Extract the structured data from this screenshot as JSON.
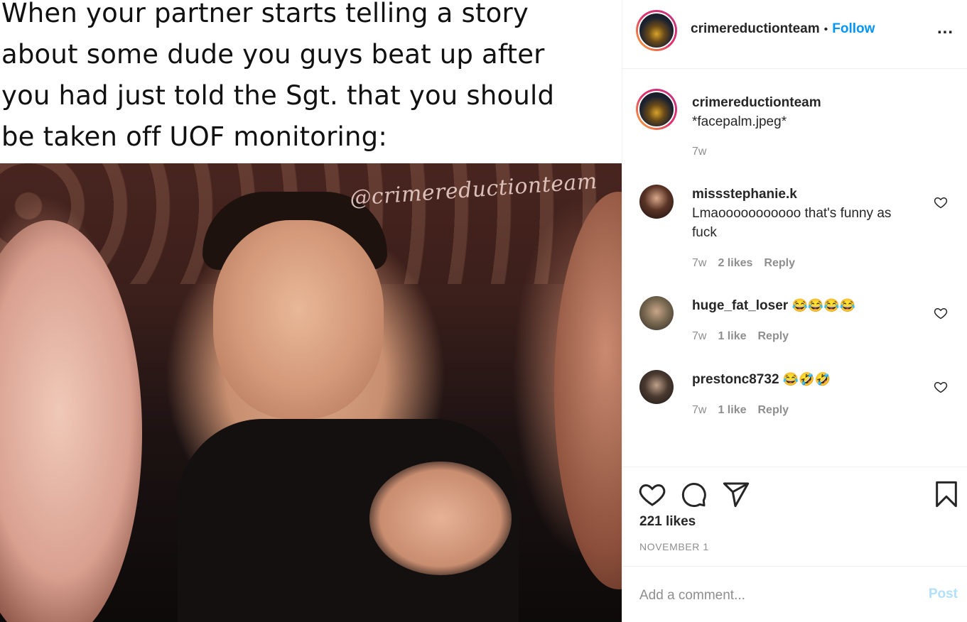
{
  "post": {
    "meme_caption": "When your partner starts telling a story\nabout some dude you guys beat up after\nyou had just told the Sgt. that you should\nbe taken off UOF monitoring:",
    "watermark": "@crimereductionteam"
  },
  "header": {
    "username": "crimereductionteam",
    "separator": "•",
    "follow_label": "Follow",
    "more_label": "..."
  },
  "caption": {
    "username": "crimereductionteam",
    "text": "*facepalm.jpeg*",
    "time": "7w"
  },
  "comments": [
    {
      "username": "missstephanie.k",
      "text": "Lmaooooooooooo that's funny as fuck",
      "time": "7w",
      "likes": "2 likes",
      "reply": "Reply"
    },
    {
      "username": "huge_fat_loser",
      "text": "😂😂😂😂",
      "time": "7w",
      "likes": "1 like",
      "reply": "Reply"
    },
    {
      "username": "prestonc8732",
      "text": "😂🤣🤣",
      "time": "7w",
      "likes": "1 like",
      "reply": "Reply"
    }
  ],
  "actions": {
    "icons": [
      "heart-icon",
      "comment-icon",
      "share-icon",
      "bookmark-icon"
    ],
    "likes": "221 likes",
    "date": "NOVEMBER 1"
  },
  "add_comment": {
    "placeholder": "Add a comment...",
    "post_label": "Post"
  },
  "colors": {
    "link": "#0095f6",
    "muted": "#8e8e8e",
    "post_disabled": "#b2dffc"
  }
}
